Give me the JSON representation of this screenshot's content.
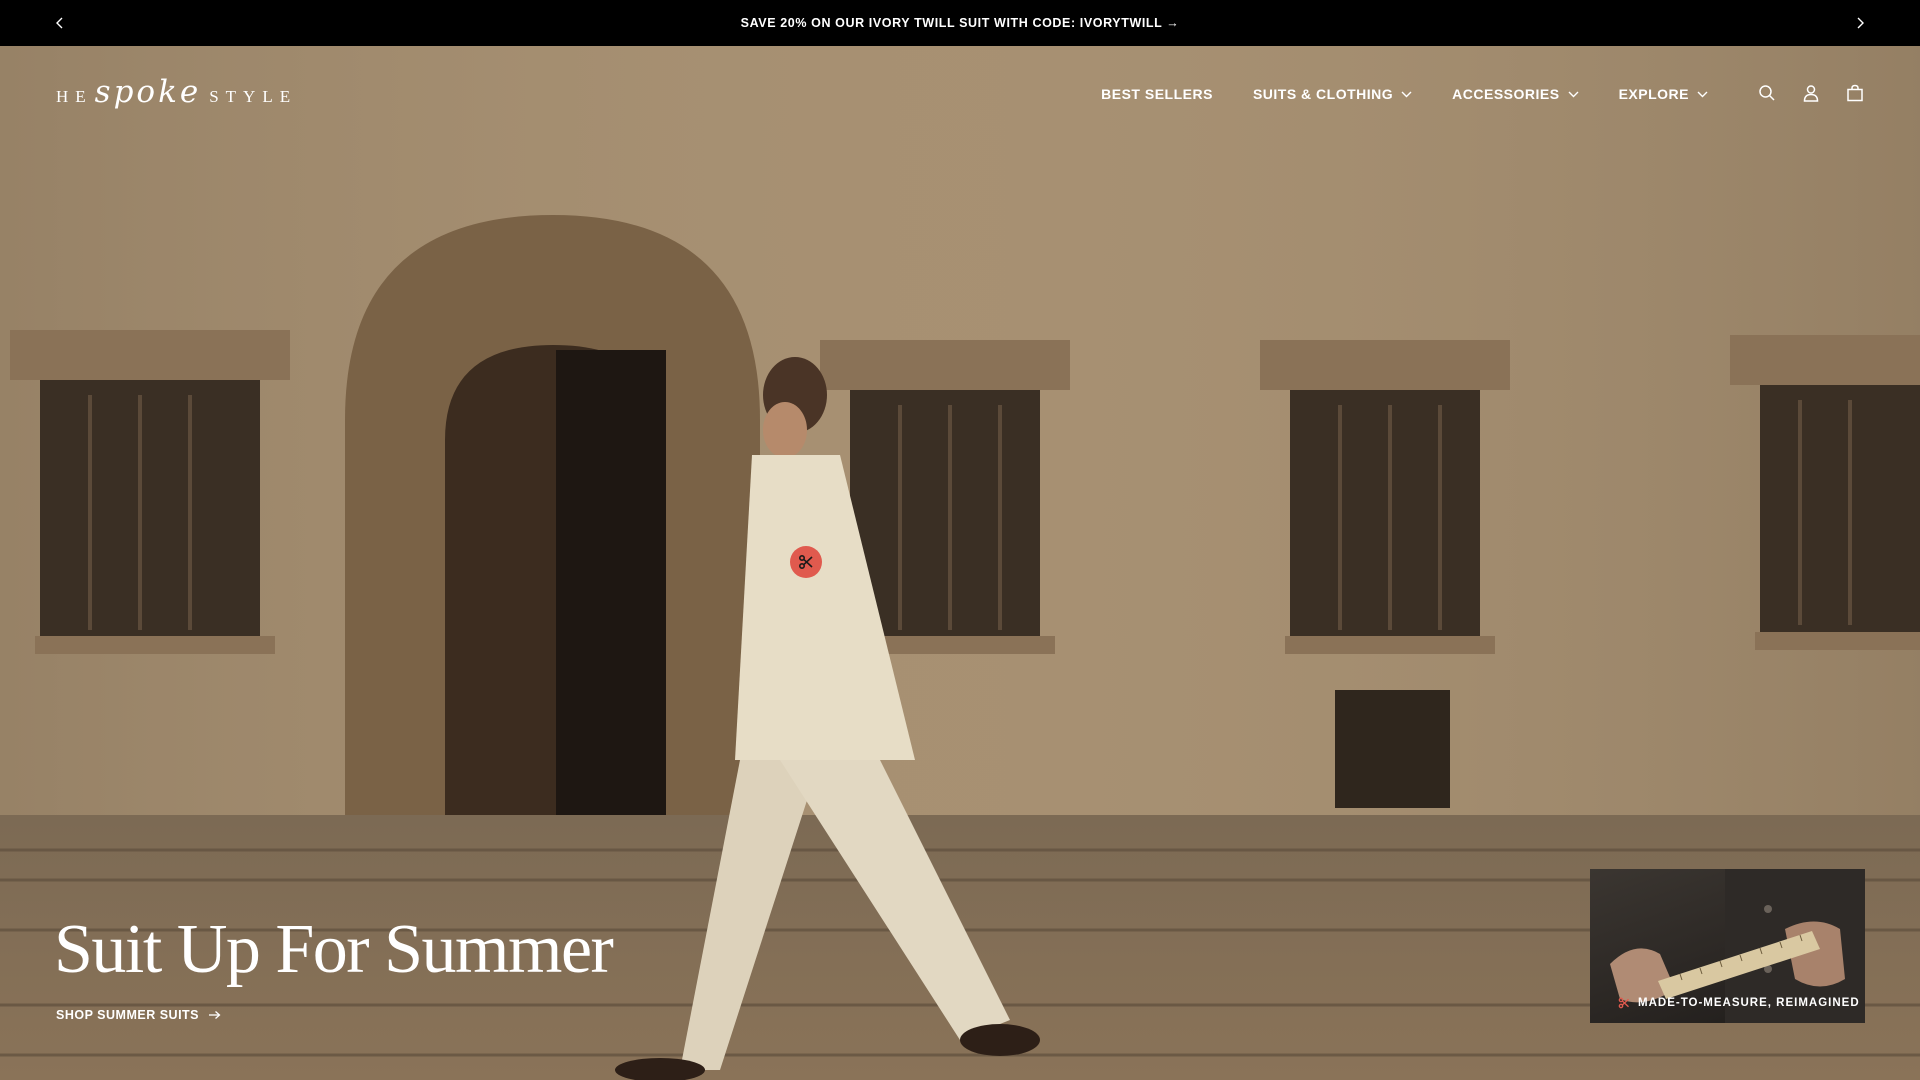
{
  "announcement": {
    "text": "SAVE 20% ON OUR IVORY TWILL SUIT WITH CODE: IVORYTWILL →",
    "prev_icon": "chevron-left-icon",
    "next_icon": "chevron-right-icon"
  },
  "header": {
    "logo": {
      "prefix": "HE",
      "script": "spoke",
      "suffix": "STYLE"
    },
    "nav": [
      {
        "label": "BEST SELLERS",
        "has_dropdown": false
      },
      {
        "label": "SUITS & CLOTHING",
        "has_dropdown": true
      },
      {
        "label": "ACCESSORIES",
        "has_dropdown": true
      },
      {
        "label": "EXPLORE",
        "has_dropdown": true
      }
    ],
    "icons": [
      "search-icon",
      "account-icon",
      "bag-icon"
    ]
  },
  "hero": {
    "headline": "Suit Up For Summer",
    "cta_label": "SHOP SUMMER SUITS",
    "marker_icon": "scissors-icon"
  },
  "promo_card": {
    "caption": "MADE-TO-MEASURE, REIMAGINED",
    "icon": "scissors-icon"
  },
  "colors": {
    "announcement_bg": "#000000",
    "accent": "#e05a4e",
    "text": "#ffffff"
  }
}
